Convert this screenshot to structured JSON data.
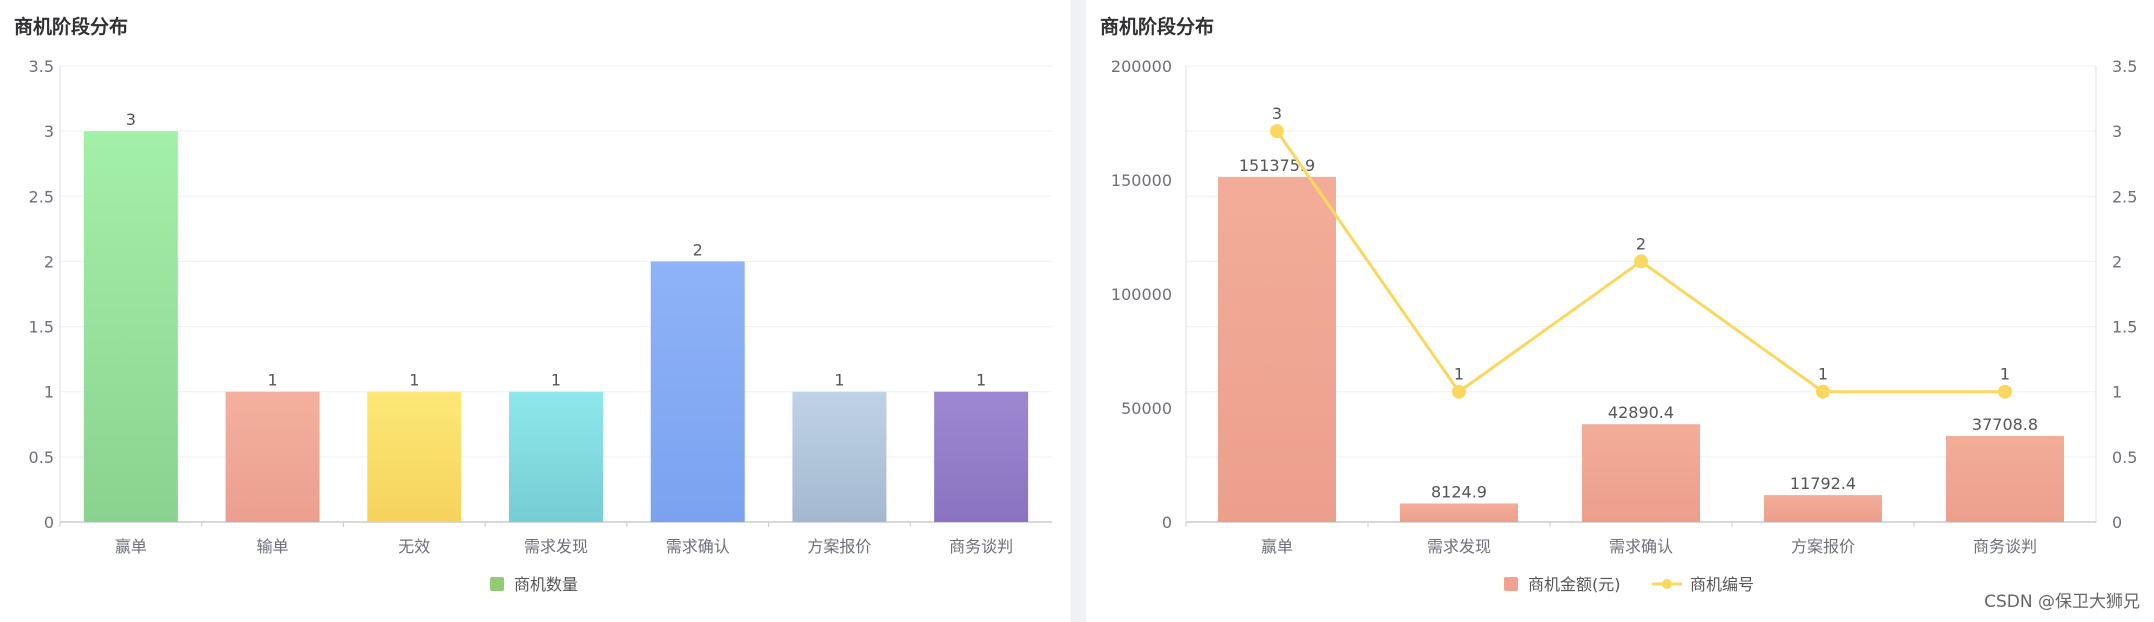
{
  "panels": [
    {
      "title": "商机阶段分布"
    },
    {
      "title": "商机阶段分布"
    }
  ],
  "watermark": "CSDN @保卫大狮兄",
  "chart_data": [
    {
      "type": "bar",
      "title": "商机阶段分布",
      "categories": [
        "赢单",
        "输单",
        "无效",
        "需求发现",
        "需求确认",
        "方案报价",
        "商务谈判"
      ],
      "series": [
        {
          "name": "商机数量",
          "values": [
            3,
            1,
            1,
            1,
            2,
            1,
            1
          ],
          "color": "#91cc75"
        }
      ],
      "bar_colors": [
        [
          "#a3f0a8",
          "#8ad38f"
        ],
        [
          "#f4b09e",
          "#ec9f8f"
        ],
        [
          "#fce877",
          "#f5d35c"
        ],
        [
          "#8ee8ea",
          "#76cdd4"
        ],
        [
          "#8fb3f8",
          "#7aa2f0"
        ],
        [
          "#bfd2e8",
          "#a4b8cf"
        ],
        [
          "#9d88d2",
          "#8a74c1"
        ]
      ],
      "ylim": [
        0,
        3.5
      ],
      "yticks": [
        "0",
        "0.5",
        "1",
        "1.5",
        "2",
        "2.5",
        "3",
        "3.5"
      ],
      "data_labels": [
        "3",
        "1",
        "1",
        "1",
        "2",
        "1",
        "1"
      ],
      "legend": {
        "label": "商机数量",
        "color": "#91cc75",
        "position": "bottom-center"
      },
      "grid": true
    },
    {
      "type": "bar",
      "title": "商机阶段分布",
      "categories": [
        "赢单",
        "需求发现",
        "需求确认",
        "方案报价",
        "商务谈判"
      ],
      "series": [
        {
          "name": "商机金额(元)",
          "type": "bar",
          "axis": "left",
          "values": [
            151375.9,
            8124.9,
            42890.4,
            11792.4,
            37708.8
          ],
          "labels": [
            "151375.9",
            "8124.9",
            "42890.4",
            "11792.4",
            "37708.8"
          ],
          "color": "#f0a28e"
        },
        {
          "name": "商机编号",
          "type": "line",
          "axis": "right",
          "values": [
            3,
            1,
            2,
            1,
            1
          ],
          "labels": [
            "3",
            "1",
            "2",
            "1",
            "1"
          ],
          "color": "#fad860"
        }
      ],
      "ylim_left": [
        0,
        200000
      ],
      "yticks_left": [
        "0",
        "50000",
        "100000",
        "150000",
        "200000"
      ],
      "ylim_right": [
        0,
        3.5
      ],
      "yticks_right": [
        "0",
        "0.5",
        "1",
        "1.5",
        "2",
        "2.5",
        "3",
        "3.5"
      ],
      "legend": {
        "position": "bottom-center"
      },
      "grid": true
    }
  ]
}
